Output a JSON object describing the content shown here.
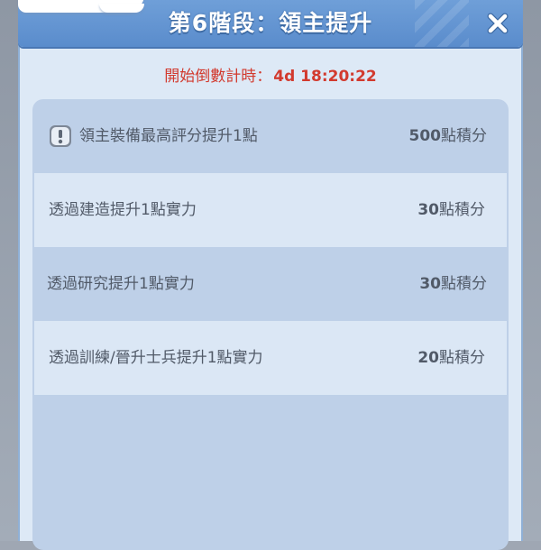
{
  "dialog": {
    "title": "第6階段：領主提升",
    "close_icon": "close-icon"
  },
  "countdown": {
    "label": "開始倒數計時：",
    "value": "4d 18:20:22",
    "color": "#d23a2e"
  },
  "tasks": [
    {
      "label": "領主裝備最高評分提升1點",
      "points": "500",
      "unit": "點積分",
      "icon": "alert-icon"
    },
    {
      "label": "透過建造提升1點實力",
      "points": "30",
      "unit": "點積分"
    },
    {
      "label": "透過研究提升1點實力",
      "points": "30",
      "unit": "點積分"
    },
    {
      "label": "透過訓練/晉升士兵提升1點實力",
      "points": "20",
      "unit": "點積分"
    }
  ]
}
